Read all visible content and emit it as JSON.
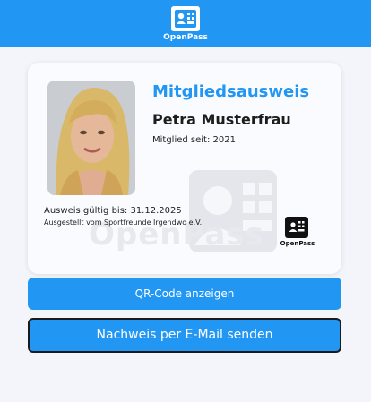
{
  "header": {
    "app_name": "OpenPass",
    "logo_icon": "id-card-qr-icon",
    "background": "#2196f3"
  },
  "card": {
    "title": "Mitgliedsausweis",
    "member_name": "Petra Musterfrau",
    "member_since": "Mitglied seit: 2021",
    "valid_until": "Ausweis gültig bis: 31.12.2025",
    "issued_by": "Ausgestellt vom Sportfreunde Irgendwo e.V.",
    "watermark_text": "OpenPass",
    "badge_name": "OpenPass",
    "accent": "#2196f3"
  },
  "actions": {
    "qr_label": "QR-Code anzeigen",
    "email_label": "Nachweis per E-Mail senden"
  }
}
